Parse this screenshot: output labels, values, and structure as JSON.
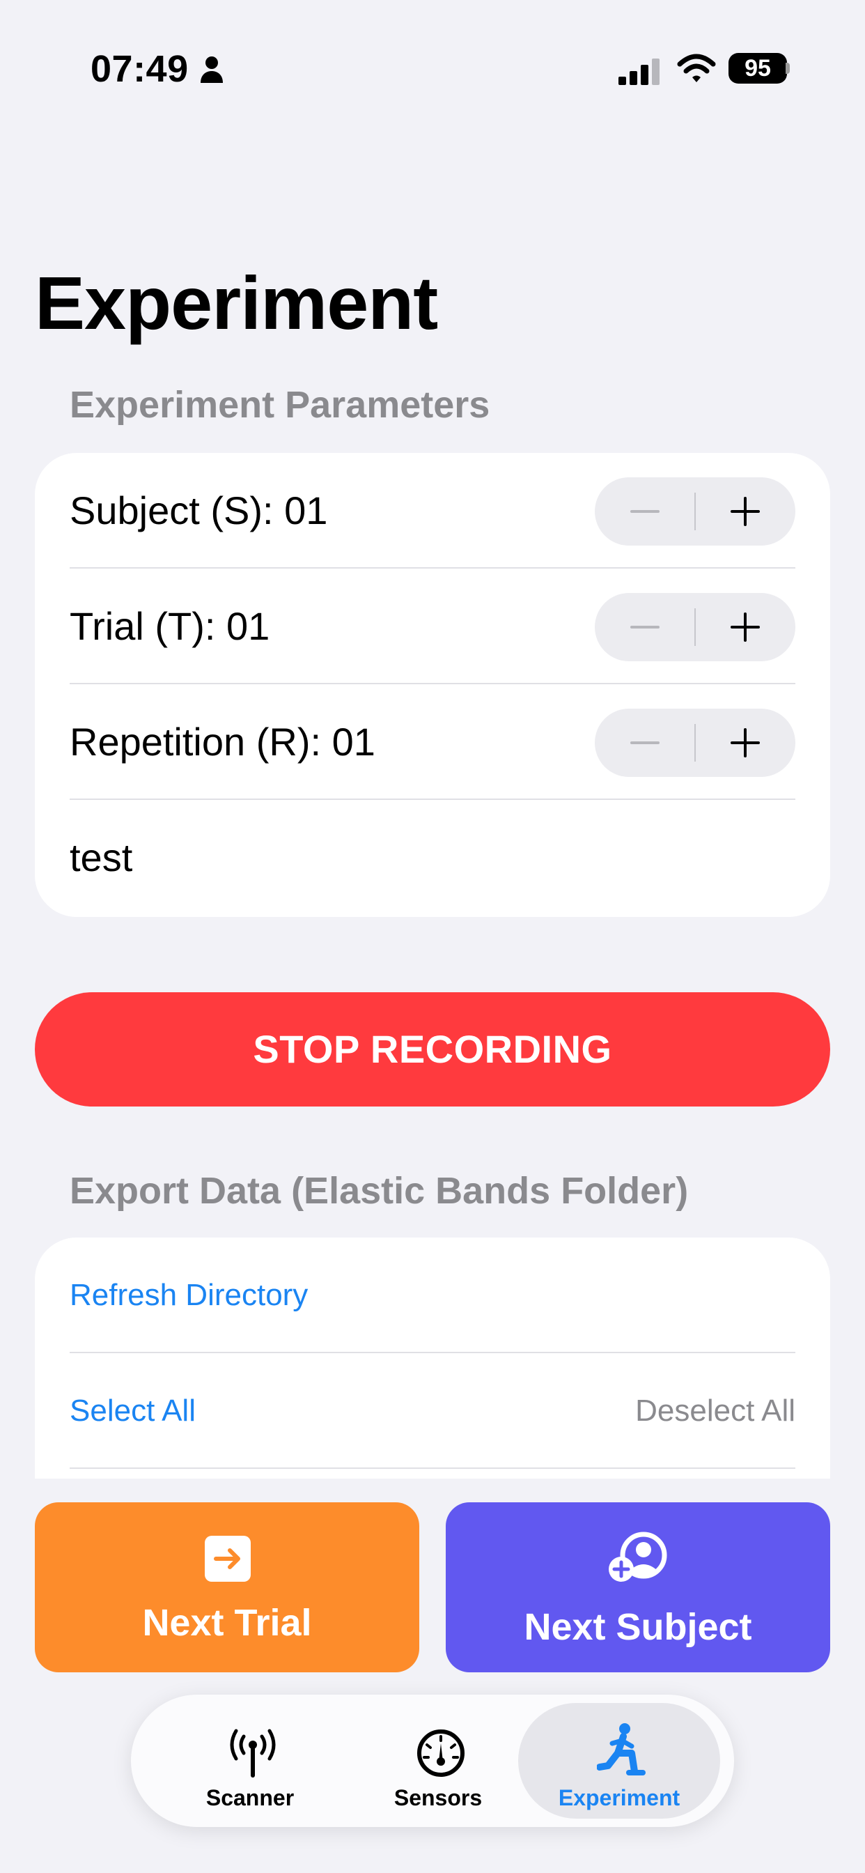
{
  "status_bar": {
    "time": "07:49",
    "battery": "95"
  },
  "page": {
    "title": "Experiment"
  },
  "params": {
    "header": "Experiment Parameters",
    "subject_label": "Subject (S): 01",
    "trial_label": "Trial (T): 01",
    "repetition_label": "Repetition (R): 01",
    "note_value": "test"
  },
  "stop_button": "STOP RECORDING",
  "export": {
    "header": "Export Data (Elastic Bands Folder)",
    "refresh": "Refresh Directory",
    "select_all": "Select All",
    "deselect_all": "Deselect All"
  },
  "actions": {
    "next_trial": "Next Trial",
    "next_subject": "Next Subject"
  },
  "tabs": [
    {
      "label": "Scanner",
      "icon": "antenna-icon",
      "active": false
    },
    {
      "label": "Sensors",
      "icon": "gauge-icon",
      "active": false
    },
    {
      "label": "Experiment",
      "icon": "figure-lunge-icon",
      "active": true
    }
  ],
  "colors": {
    "background": "#f2f2f7",
    "stop": "#ff3a3e",
    "next_trial": "#fd8c2b",
    "next_subject": "#6158f0",
    "link": "#1a84f2"
  }
}
